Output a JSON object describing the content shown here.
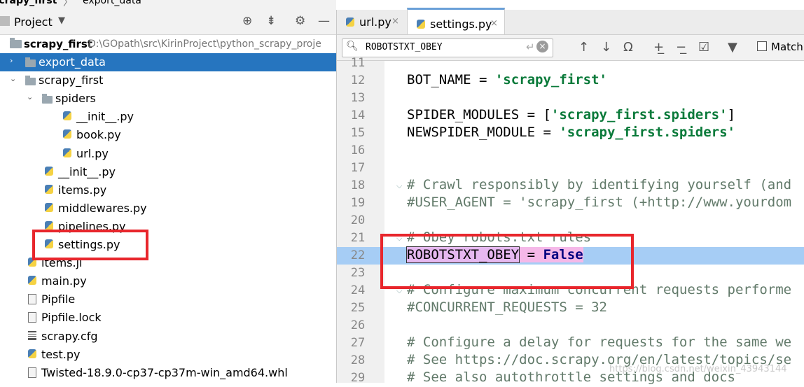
{
  "breadcrumb": {
    "root": "scrapy_first",
    "sep": "〉",
    "child": "export_data"
  },
  "project_panel": {
    "title": "Project",
    "dropdown_icon": "chevron-down-icon",
    "tools": [
      "target-icon",
      "collapse-icon",
      "gear-icon",
      "minimize-icon"
    ],
    "root": {
      "name": "scrapy_first",
      "path": "D:\\GOpath\\src\\KirinProject\\python_scrapy_proje"
    },
    "items": [
      {
        "label": "export_data",
        "type": "folder",
        "depth": 1,
        "arrow": "›",
        "selected": true
      },
      {
        "label": "scrapy_first",
        "type": "folder",
        "depth": 1,
        "arrow": "⌄",
        "selected": false
      },
      {
        "label": "spiders",
        "type": "folder",
        "depth": 2,
        "arrow": "⌄",
        "selected": false
      },
      {
        "label": "__init__.py",
        "type": "py",
        "depth": 3,
        "arrow": "",
        "selected": false
      },
      {
        "label": "book.py",
        "type": "py",
        "depth": 3,
        "arrow": "",
        "selected": false
      },
      {
        "label": "url.py",
        "type": "py",
        "depth": 3,
        "arrow": "",
        "selected": false
      },
      {
        "label": "__init__.py",
        "type": "py",
        "depth": 2,
        "arrow": "",
        "selected": false
      },
      {
        "label": "items.py",
        "type": "py",
        "depth": 2,
        "arrow": "",
        "selected": false
      },
      {
        "label": "middlewares.py",
        "type": "py",
        "depth": 2,
        "arrow": "",
        "selected": false
      },
      {
        "label": "pipelines.py",
        "type": "py",
        "depth": 2,
        "arrow": "",
        "selected": false
      },
      {
        "label": "settings.py",
        "type": "py",
        "depth": 2,
        "arrow": "",
        "selected": false
      },
      {
        "label": "items.jl",
        "type": "py",
        "depth": 1,
        "arrow": "",
        "selected": false
      },
      {
        "label": "main.py",
        "type": "py",
        "depth": 1,
        "arrow": "",
        "selected": false
      },
      {
        "label": "Pipfile",
        "type": "txt",
        "depth": 1,
        "arrow": "",
        "selected": false
      },
      {
        "label": "Pipfile.lock",
        "type": "txt",
        "depth": 1,
        "arrow": "",
        "selected": false
      },
      {
        "label": "scrapy.cfg",
        "type": "cfg",
        "depth": 1,
        "arrow": "",
        "selected": false
      },
      {
        "label": "test.py",
        "type": "py",
        "depth": 1,
        "arrow": "",
        "selected": false
      },
      {
        "label": "Twisted-18.9.0-cp37-cp37m-win_amd64.whl",
        "type": "txt",
        "depth": 1,
        "arrow": "",
        "selected": false
      }
    ]
  },
  "editor": {
    "tabs": [
      {
        "label": "url.py",
        "close": "×",
        "active": false
      },
      {
        "label": "settings.py",
        "close": "×",
        "active": true
      }
    ],
    "search": {
      "value": "ROBOTSTXT_OBEY",
      "search_icon": "search-icon",
      "enter_glyph": "↵",
      "clear_glyph": "×",
      "buttons": [
        "up-arrow-icon",
        "down-arrow-icon",
        "find-all-icon",
        "add-occurrence-icon",
        "remove-occurrence-icon",
        "select-all-occurrences-icon",
        "filter-icon"
      ],
      "match_case_label": "Match"
    },
    "lines": [
      {
        "n": "11",
        "text": ""
      },
      {
        "n": "12",
        "text": "BOT_NAME = 'scrapy_first'"
      },
      {
        "n": "13",
        "text": ""
      },
      {
        "n": "14",
        "text": "SPIDER_MODULES = ['scrapy_first.spiders']"
      },
      {
        "n": "15",
        "text": "NEWSPIDER_MODULE = 'scrapy_first.spiders'"
      },
      {
        "n": "16",
        "text": ""
      },
      {
        "n": "17",
        "text": ""
      },
      {
        "n": "18",
        "text": "# Crawl responsibly by identifying yourself (and"
      },
      {
        "n": "19",
        "text": "#USER_AGENT = 'scrapy_first (+http://www.yourdom"
      },
      {
        "n": "20",
        "text": ""
      },
      {
        "n": "21",
        "text": "# Obey robots.txt rules"
      },
      {
        "n": "22",
        "text": "ROBOTSTXT_OBEY = False"
      },
      {
        "n": "23",
        "text": ""
      },
      {
        "n": "24",
        "text": "# Configure maximum concurrent requests performe"
      },
      {
        "n": "25",
        "text": "#CONCURRENT_REQUESTS = 32"
      },
      {
        "n": "26",
        "text": ""
      },
      {
        "n": "27",
        "text": "# Configure a delay for requests for the same we"
      },
      {
        "n": "28",
        "text": "# See https://doc.scrapy.org/en/latest/topics/se"
      },
      {
        "n": "29",
        "text": "# See also autothrottle settings and docs"
      }
    ],
    "highlighted_line": "22",
    "watermark": "https://blog.csdn.net/weixin_43943144"
  },
  "colors": {
    "selection": "#2675bf",
    "highlight": "#a6cdf5",
    "annotation_box": "#e8262c",
    "string": "#0a7a3a",
    "comment": "#627a6a"
  }
}
